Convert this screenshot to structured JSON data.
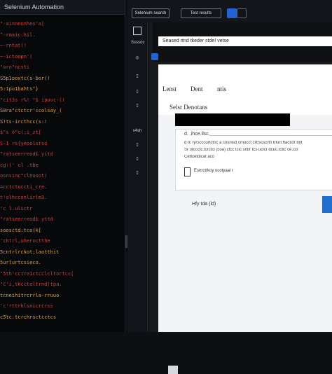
{
  "editor": {
    "title": "Selenium Automation",
    "lines": [
      {
        "text": "\"-ainnnonhes'a[",
        "color": "#c64242"
      },
      {
        "text": "^-rmaic.hil.",
        "color": "#cc4a4a"
      },
      {
        "text": "~-rntat(!",
        "color": "#c64242"
      },
      {
        "text": "~-ictoopn'(",
        "color": "#cc4a4a"
      },
      {
        "text": "\"orn\"ncvti",
        "color": "#c64242"
      },
      {
        "text": "S5p1ooxtc(s-bor(!",
        "color": "#e2a33d"
      },
      {
        "text": "5:1pu1bahts\"}",
        "color": "#e2a33d"
      },
      {
        "text": "\"cit3s r%! \"$ ipuvc-(!",
        "color": "#c64242"
      },
      {
        "text": "S0ra\"ctctcr'ccolsay_(",
        "color": "#e2a33d"
      },
      {
        "text": "S!ts-ircthcc(s:!",
        "color": "#e2a33d"
      },
      {
        "text": "$\"s o\"c(;i_zt[",
        "color": "#c64242"
      },
      {
        "text": "S-1 rs{yeoolorso",
        "color": "#d23f3f"
      },
      {
        "text": "\"ratseerreod$ yitd",
        "color": "#c64242"
      },
      {
        "text": "cg:(' cl .tbe",
        "color": "#cc4a4a"
      },
      {
        "text": "osnsinc\"clhosot(",
        "color": "#c64242"
      },
      {
        "text": "=cctctuccti_cre.",
        "color": "#cc4a4a"
      },
      {
        "text": "t'olhcconlirlm3.",
        "color": "#c64242"
      },
      {
        "text": "'c l.ulictr",
        "color": "#cc4a4a"
      },
      {
        "text": "\"ratseerreod$ yttd",
        "color": "#c64242"
      },
      {
        "text": "soosctd:tco(k[",
        "color": "#e2a33d"
      },
      {
        "text": "'chtrl,uheroctthe",
        "color": "#c64242"
      },
      {
        "text": "5cntrlrckot;laotthit",
        "color": "#e2a33d"
      },
      {
        "text": "5urlurtcsieco.",
        "color": "#e2a33d"
      },
      {
        "text": "\"5th'cctre1ctcclcltortcc[",
        "color": "#c64242"
      },
      {
        "text": "\"C'i,tkccteltrnd)tpa.",
        "color": "#c64242"
      },
      {
        "text": "tcneihitrcrrla-rruuo",
        "color": "#e2a33d"
      },
      {
        "text": "'c'rttrklsnicrcrss",
        "color": "#c64242"
      },
      {
        "text": "c5tc.tcrchrsctcctcs",
        "color": "#e2a33d"
      }
    ]
  },
  "rail": {
    "items": [
      "",
      "Ssssos",
      "",
      "",
      "",
      "",
      "s4sh",
      "",
      "",
      ""
    ]
  },
  "topbar": {
    "pill_1": "Selenium search",
    "pill_2": "Test results"
  },
  "browser": {
    "url": "Seased rtnd tkeder stde! vetse",
    "nav": {
      "item_1": "Lenst",
      "item_2": "Dent",
      "item_3": "ntis"
    },
    "section_title": "Selsr Denotans",
    "card": {
      "heading": "d. .ihce.ilsc.",
      "lines": [
        "d tc ryrscccurfctnc a cosriisd cmocct crtrscscrtn trlurr.ftactctr bnt",
        "Sr otccctc.tcrctcl (coa) ctcc tcic sntlr tcs uclcr dcuc.tctlc ce.ccr",
        "Cettcetdicat aco"
      ],
      "checkbox_label": "Esnrctrkoy ocotyaal r"
    },
    "footer_text": "Hfy Ida (ld)"
  }
}
